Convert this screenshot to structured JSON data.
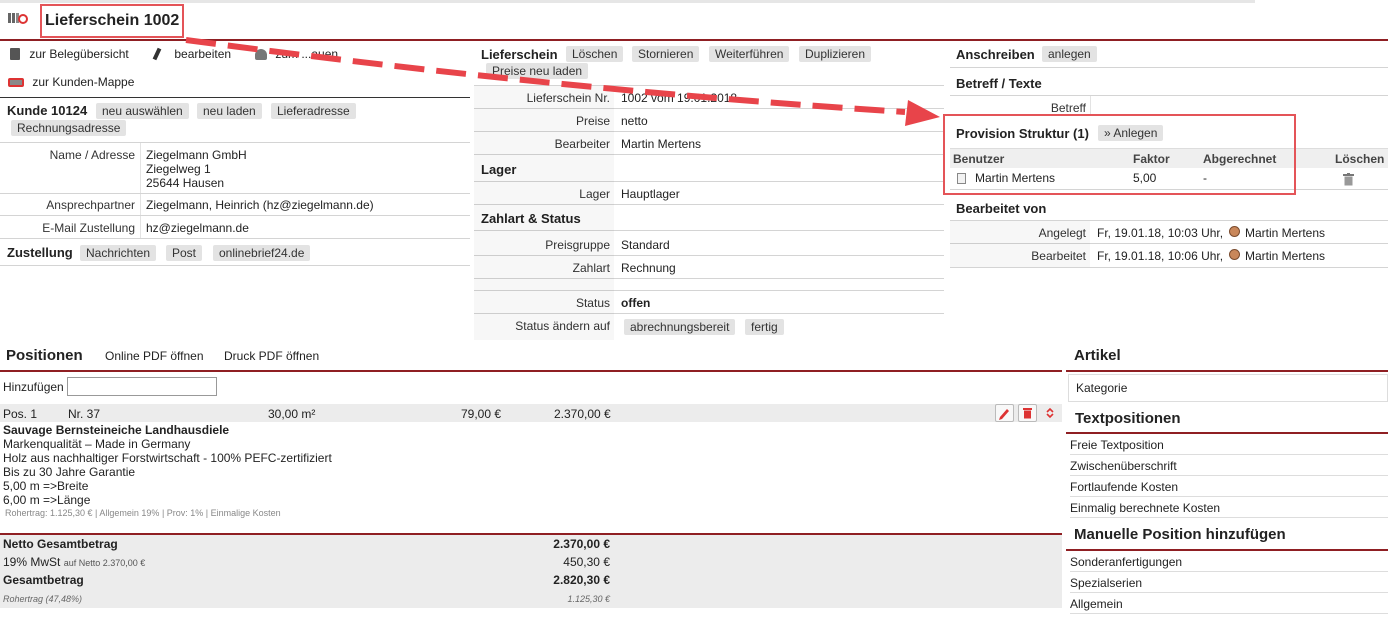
{
  "header": {
    "title": "Lieferschein 1002"
  },
  "left_nav": {
    "overview": "zur Belegübersicht",
    "edit": "bearbeiten",
    "move": "zum ...auen",
    "customer_folder": "zur Kunden-Mappe"
  },
  "customer": {
    "title": "Kunde 10124",
    "buttons": [
      "neu auswählen",
      "neu laden",
      "Lieferadresse",
      "Rechnungsadresse"
    ],
    "name_label": "Name / Adresse",
    "name_lines": [
      "Ziegelmann GmbH",
      "Ziegelweg 1",
      "25644 Hausen"
    ],
    "contact_label": "Ansprechpartner",
    "contact_value": "Ziegelmann, Heinrich (hz@ziegelmann.de)",
    "email_label": "E-Mail Zustellung",
    "email_value": "hz@ziegelmann.de"
  },
  "delivery": {
    "title": "Zustellung",
    "buttons": [
      "Nachrichten",
      "Post",
      "onlinebrief24.de"
    ]
  },
  "lieferschein": {
    "title": "Lieferschein",
    "buttons": [
      "Löschen",
      "Stornieren",
      "Weiterführen",
      "Duplizieren",
      "Preise neu laden"
    ],
    "nr_label": "Lieferschein Nr.",
    "nr_value": "1002 vom 19.01.2018",
    "preise_label": "Preise",
    "preise_value": "netto",
    "bearbeiter_label": "Bearbeiter",
    "bearbeiter_value": "Martin Mertens",
    "lager_title": "Lager",
    "lager_label": "Lager",
    "lager_value": "Hauptlager",
    "zahlart_title": "Zahlart & Status",
    "preisgruppe_label": "Preisgruppe",
    "preisgruppe_value": "Standard",
    "zahlart_label": "Zahlart",
    "zahlart_value": "Rechnung",
    "status_label": "Status",
    "status_value": "offen",
    "status_change_label": "Status ändern auf",
    "status_buttons": [
      "abrechnungsbereit",
      "fertig"
    ]
  },
  "right": {
    "anschreiben_title": "Anschreiben",
    "anschreiben_button": "anlegen",
    "betreff_title": "Betreff / Texte",
    "betreff_label": "Betreff",
    "provision_title": "Provision Struktur (1)",
    "provision_button": "» Anlegen",
    "provision_headers": [
      "Benutzer",
      "Faktor",
      "Abgerechnet",
      "Löschen"
    ],
    "provision_row": {
      "user": "Martin Mertens",
      "factor": "5,00",
      "settled": "-"
    },
    "bearbeitet_title": "Bearbeitet von",
    "angelegt_label": "Angelegt",
    "angelegt_value": "Fr, 19.01.18, 10:03 Uhr,",
    "angelegt_user": "Martin Mertens",
    "bearbeitet_label": "Bearbeitet",
    "bearbeitet_value": "Fr, 19.01.18, 10:06 Uhr,",
    "bearbeitet_user": "Martin Mertens"
  },
  "positions": {
    "title": "Positionen",
    "online_pdf": "Online PDF öffnen",
    "print_pdf": "Druck PDF öffnen",
    "add_label": "Hinzufügen",
    "add_placeholder": "",
    "item": {
      "pos": "Pos. 1",
      "nr": "Nr. 37",
      "qty": "30,00 m²",
      "price": "79,00 €",
      "total": "2.370,00 €",
      "name": "Sauvage Bernsteineiche Landhausdiele",
      "lines": [
        "Markenqualität – Made in Germany",
        "Holz aus nachhaltiger Forstwirtschaft - 100% PEFC-zertifiziert",
        "Bis zu 30 Jahre Garantie",
        "5,00 m =>Breite",
        "6,00 m =>Länge"
      ],
      "meta": "Rohertrag: 1.125,30 € | Allgemein 19% | Prov: 1% | Einmalige Kosten"
    },
    "totals": {
      "netto_label": "Netto Gesamtbetrag",
      "netto_value": "2.370,00 €",
      "mwst_label": "19% MwSt",
      "mwst_sub": "auf Netto 2.370,00 €",
      "mwst_value": "450,30 €",
      "gesamt_label": "Gesamtbetrag",
      "gesamt_value": "2.820,30 €",
      "roh_label": "Rohertrag (47,48%)",
      "roh_value": "1.125,30 €"
    }
  },
  "sidebar": {
    "artikel_title": "Artikel",
    "kategorie": "Kategorie",
    "textpos_title": "Textpositionen",
    "textpos_items": [
      "Freie Textposition",
      "Zwischenüberschrift",
      "Fortlaufende Kosten",
      "Einmalig berechnete Kosten"
    ],
    "manual_title": "Manuelle Position hinzufügen",
    "manual_items": [
      "Sonderanfertigungen",
      "Spezialserien",
      "Allgemein"
    ]
  },
  "colors": {
    "accent": "#8f1f23",
    "highlight": "#e45458",
    "arrow": "#e8444a"
  }
}
